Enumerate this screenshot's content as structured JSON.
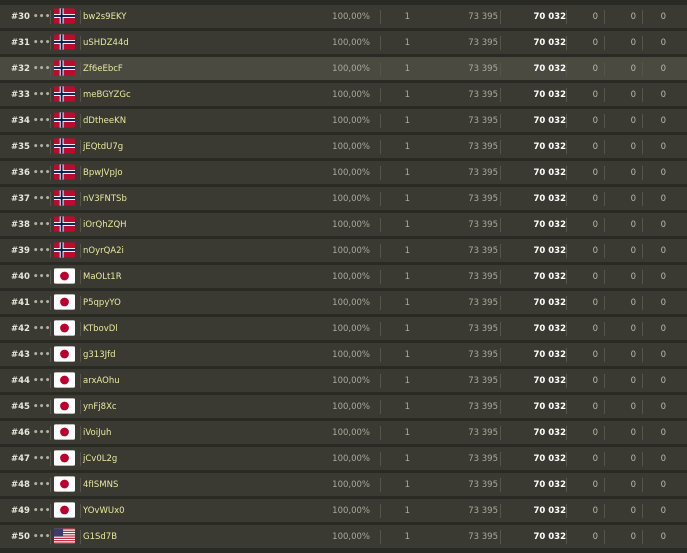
{
  "flag_icons": {
    "NO": "norway-flag-icon",
    "JP": "japan-flag-icon",
    "US": "usa-flag-icon"
  },
  "menu_glyph": "•••",
  "highlight_rank": "#32",
  "rows": [
    {
      "rank": "#30",
      "flag": "NO",
      "name": "bw2s9EKY",
      "percent": "100,00%",
      "count": "1",
      "points": "73 395",
      "score": "70 032",
      "z1": "0",
      "z2": "0",
      "z3": "0"
    },
    {
      "rank": "#31",
      "flag": "NO",
      "name": "uSHDZ44d",
      "percent": "100,00%",
      "count": "1",
      "points": "73 395",
      "score": "70 032",
      "z1": "0",
      "z2": "0",
      "z3": "0"
    },
    {
      "rank": "#32",
      "flag": "NO",
      "name": "Zf6eEbcF",
      "percent": "100,00%",
      "count": "1",
      "points": "73 395",
      "score": "70 032",
      "z1": "0",
      "z2": "0",
      "z3": "0"
    },
    {
      "rank": "#33",
      "flag": "NO",
      "name": "meBGYZGc",
      "percent": "100,00%",
      "count": "1",
      "points": "73 395",
      "score": "70 032",
      "z1": "0",
      "z2": "0",
      "z3": "0"
    },
    {
      "rank": "#34",
      "flag": "NO",
      "name": "dDtheeKN",
      "percent": "100,00%",
      "count": "1",
      "points": "73 395",
      "score": "70 032",
      "z1": "0",
      "z2": "0",
      "z3": "0"
    },
    {
      "rank": "#35",
      "flag": "NO",
      "name": "jEQtdU7g",
      "percent": "100,00%",
      "count": "1",
      "points": "73 395",
      "score": "70 032",
      "z1": "0",
      "z2": "0",
      "z3": "0"
    },
    {
      "rank": "#36",
      "flag": "NO",
      "name": "BpwJVpJo",
      "percent": "100,00%",
      "count": "1",
      "points": "73 395",
      "score": "70 032",
      "z1": "0",
      "z2": "0",
      "z3": "0"
    },
    {
      "rank": "#37",
      "flag": "NO",
      "name": "nV3FNTSb",
      "percent": "100,00%",
      "count": "1",
      "points": "73 395",
      "score": "70 032",
      "z1": "0",
      "z2": "0",
      "z3": "0"
    },
    {
      "rank": "#38",
      "flag": "NO",
      "name": "iOrQhZQH",
      "percent": "100,00%",
      "count": "1",
      "points": "73 395",
      "score": "70 032",
      "z1": "0",
      "z2": "0",
      "z3": "0"
    },
    {
      "rank": "#39",
      "flag": "NO",
      "name": "nOyrQA2i",
      "percent": "100,00%",
      "count": "1",
      "points": "73 395",
      "score": "70 032",
      "z1": "0",
      "z2": "0",
      "z3": "0"
    },
    {
      "rank": "#40",
      "flag": "JP",
      "name": "MaOLt1R",
      "percent": "100,00%",
      "count": "1",
      "points": "73 395",
      "score": "70 032",
      "z1": "0",
      "z2": "0",
      "z3": "0"
    },
    {
      "rank": "#41",
      "flag": "JP",
      "name": "P5qpyYO",
      "percent": "100,00%",
      "count": "1",
      "points": "73 395",
      "score": "70 032",
      "z1": "0",
      "z2": "0",
      "z3": "0"
    },
    {
      "rank": "#42",
      "flag": "JP",
      "name": "KTbovDl",
      "percent": "100,00%",
      "count": "1",
      "points": "73 395",
      "score": "70 032",
      "z1": "0",
      "z2": "0",
      "z3": "0"
    },
    {
      "rank": "#43",
      "flag": "JP",
      "name": "g313Jfd",
      "percent": "100,00%",
      "count": "1",
      "points": "73 395",
      "score": "70 032",
      "z1": "0",
      "z2": "0",
      "z3": "0"
    },
    {
      "rank": "#44",
      "flag": "JP",
      "name": "arxAOhu",
      "percent": "100,00%",
      "count": "1",
      "points": "73 395",
      "score": "70 032",
      "z1": "0",
      "z2": "0",
      "z3": "0"
    },
    {
      "rank": "#45",
      "flag": "JP",
      "name": "ynFj8Xc",
      "percent": "100,00%",
      "count": "1",
      "points": "73 395",
      "score": "70 032",
      "z1": "0",
      "z2": "0",
      "z3": "0"
    },
    {
      "rank": "#46",
      "flag": "JP",
      "name": "iVoiJuh",
      "percent": "100,00%",
      "count": "1",
      "points": "73 395",
      "score": "70 032",
      "z1": "0",
      "z2": "0",
      "z3": "0"
    },
    {
      "rank": "#47",
      "flag": "JP",
      "name": "jCv0L2g",
      "percent": "100,00%",
      "count": "1",
      "points": "73 395",
      "score": "70 032",
      "z1": "0",
      "z2": "0",
      "z3": "0"
    },
    {
      "rank": "#48",
      "flag": "JP",
      "name": "4fISMNS",
      "percent": "100,00%",
      "count": "1",
      "points": "73 395",
      "score": "70 032",
      "z1": "0",
      "z2": "0",
      "z3": "0"
    },
    {
      "rank": "#49",
      "flag": "JP",
      "name": "YOvWUx0",
      "percent": "100,00%",
      "count": "1",
      "points": "73 395",
      "score": "70 032",
      "z1": "0",
      "z2": "0",
      "z3": "0"
    },
    {
      "rank": "#50",
      "flag": "US",
      "name": "G1Sd7B",
      "percent": "100,00%",
      "count": "1",
      "points": "73 395",
      "score": "70 032",
      "z1": "0",
      "z2": "0",
      "z3": "0"
    }
  ]
}
